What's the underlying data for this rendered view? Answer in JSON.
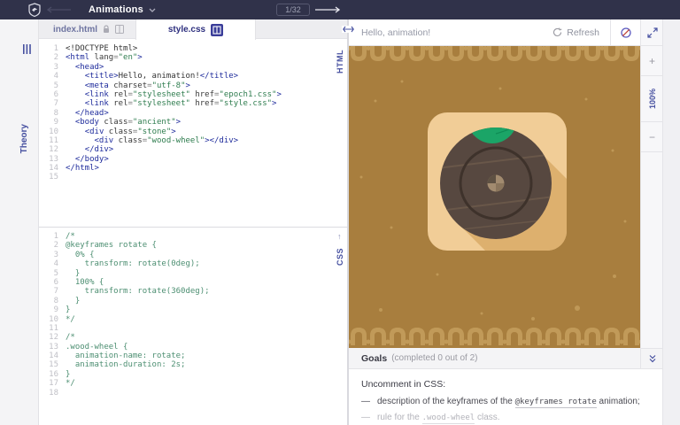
{
  "topbar": {
    "course": "Animations",
    "progress": "1/32"
  },
  "sidebar": {
    "theory_label": "Theory"
  },
  "tabs": [
    {
      "label": "index.html",
      "locked": true,
      "active": false
    },
    {
      "label": "style.css",
      "locked": false,
      "active": true
    }
  ],
  "editors": {
    "html": {
      "label": "HTML",
      "lines": [
        [
          [
            "pl",
            "<!DOCTYPE html>"
          ]
        ],
        [
          [
            "tg",
            "<html"
          ],
          [
            "at",
            " lang"
          ],
          [
            "pu",
            "="
          ],
          [
            "st",
            "\"en\""
          ],
          [
            "tg",
            ">"
          ]
        ],
        [
          [
            "pl",
            "  "
          ],
          [
            "tg",
            "<head>"
          ]
        ],
        [
          [
            "pl",
            "    "
          ],
          [
            "tg",
            "<title>"
          ],
          [
            "pl",
            "Hello, animation!"
          ],
          [
            "tg",
            "</title>"
          ]
        ],
        [
          [
            "pl",
            "    "
          ],
          [
            "tg",
            "<meta"
          ],
          [
            "at",
            " charset"
          ],
          [
            "pu",
            "="
          ],
          [
            "st",
            "\"utf-8\""
          ],
          [
            "tg",
            ">"
          ]
        ],
        [
          [
            "pl",
            "    "
          ],
          [
            "tg",
            "<link"
          ],
          [
            "at",
            " rel"
          ],
          [
            "pu",
            "="
          ],
          [
            "st",
            "\"stylesheet\""
          ],
          [
            "at",
            " href"
          ],
          [
            "pu",
            "="
          ],
          [
            "st",
            "\"epoch1.css\""
          ],
          [
            "tg",
            ">"
          ]
        ],
        [
          [
            "pl",
            "    "
          ],
          [
            "tg",
            "<link"
          ],
          [
            "at",
            " rel"
          ],
          [
            "pu",
            "="
          ],
          [
            "st",
            "\"stylesheet\""
          ],
          [
            "at",
            " href"
          ],
          [
            "pu",
            "="
          ],
          [
            "st",
            "\"style.css\""
          ],
          [
            "tg",
            ">"
          ]
        ],
        [
          [
            "pl",
            "  "
          ],
          [
            "tg",
            "</head>"
          ]
        ],
        [
          [
            "pl",
            "  "
          ],
          [
            "tg",
            "<body"
          ],
          [
            "at",
            " class"
          ],
          [
            "pu",
            "="
          ],
          [
            "st",
            "\"ancient\""
          ],
          [
            "tg",
            ">"
          ]
        ],
        [
          [
            "pl",
            "    "
          ],
          [
            "tg",
            "<div"
          ],
          [
            "at",
            " class"
          ],
          [
            "pu",
            "="
          ],
          [
            "st",
            "\"stone\""
          ],
          [
            "tg",
            ">"
          ]
        ],
        [
          [
            "pl",
            "      "
          ],
          [
            "tg",
            "<div"
          ],
          [
            "at",
            " class"
          ],
          [
            "pu",
            "="
          ],
          [
            "st",
            "\"wood-wheel\""
          ],
          [
            "tg",
            "></div>"
          ]
        ],
        [
          [
            "pl",
            "    "
          ],
          [
            "tg",
            "</div>"
          ]
        ],
        [
          [
            "pl",
            "  "
          ],
          [
            "tg",
            "</body>"
          ]
        ],
        [
          [
            "tg",
            "</html>"
          ]
        ],
        []
      ]
    },
    "css": {
      "label": "CSS",
      "lines": [
        "/*",
        "@keyframes rotate {",
        "  0% {",
        "    transform: rotate(0deg);",
        "  }",
        "  100% {",
        "    transform: rotate(360deg);",
        "  }",
        "}",
        "*/",
        "",
        "/*",
        ".wood-wheel {",
        "  animation-name: rotate;",
        "  animation-duration: 2s;",
        "}",
        "*/",
        ""
      ]
    }
  },
  "preview": {
    "title": "Hello, animation!",
    "refresh_label": "Refresh",
    "zoom": "100%"
  },
  "goals": {
    "title": "Goals",
    "completed": "(completed 0 out of 2)",
    "instruction": "Uncomment in CSS:",
    "items": [
      {
        "muted": false,
        "segments": [
          {
            "text": "description of the keyframes of the "
          },
          {
            "code": "@keyframes rotate"
          },
          {
            "text": " animation;"
          }
        ]
      },
      {
        "muted": true,
        "segments": [
          {
            "text": "rule for the "
          },
          {
            "code": ".wood-wheel"
          },
          {
            "text": " class."
          }
        ]
      }
    ]
  },
  "icons": {
    "plus": "+",
    "minus": "−"
  },
  "palette": {
    "topbar_bg": "#30324a",
    "accent_indigo": "#4650a0",
    "tab_active_text": "#2d2f7e",
    "code_tag": "#1f2c9c",
    "code_string": "#2f7d4f",
    "code_comment": "#4d8f72",
    "stage_bg": "#a87e3e",
    "ornament": "#c19a59",
    "stone": "#f1cd97",
    "stone_shadow": "#ddb06e",
    "wheel": "#574840",
    "wheel_ring": "#3e322b",
    "leaf_green": "#1ba567",
    "hub_light": "#a28b6f",
    "hub_dark": "#5e5143"
  }
}
